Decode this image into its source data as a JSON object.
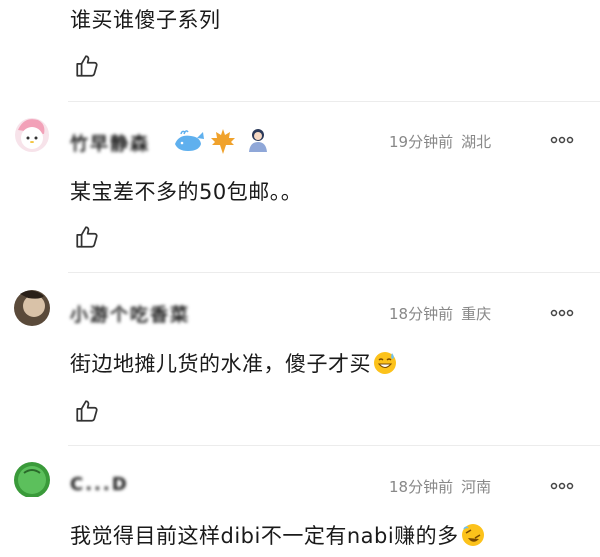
{
  "comments": [
    {
      "text": "谁买谁傻子系列"
    },
    {
      "username": "竹早静森",
      "time": "19分钟前",
      "location": "湖北",
      "text": "某宝差不多的50包邮。。"
    },
    {
      "username": "小游个吃香菜",
      "time": "18分钟前",
      "location": "重庆",
      "text": "街边地摊儿货的水准，傻子才买"
    },
    {
      "username": "C...D",
      "time": "18分钟前",
      "location": "河南",
      "text": "我觉得目前这样dibi不一定有nabi赚的多"
    }
  ],
  "icons": {
    "like": "thumbs-up-icon",
    "more": "more-dots-icon",
    "badges": [
      "whale-icon",
      "maple-leaf-icon",
      "person-icon"
    ],
    "sweat_emoji": "grinning-sweat-emoji",
    "laugh_emoji": "rolling-laughing-emoji"
  },
  "colors": {
    "text": "#1a1a1a",
    "meta": "#888888",
    "divider": "#ececec",
    "accent_orange": "#f0a22c"
  }
}
